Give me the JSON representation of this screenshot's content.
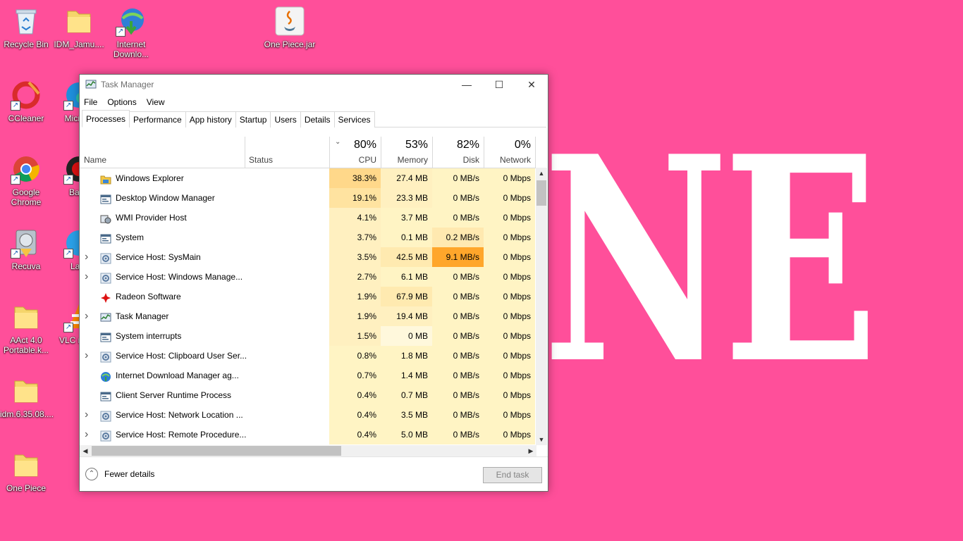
{
  "desktop": {
    "wallpaper_text": "NE",
    "icons": [
      {
        "label": "Recycle Bin",
        "icon": "recycle-bin-icon"
      },
      {
        "label": "IDM_Jamu....",
        "icon": "folder-icon"
      },
      {
        "label": "Internet Downlo...",
        "icon": "idm-icon"
      },
      {
        "label": "One Piece.jar",
        "icon": "java-icon"
      },
      {
        "label": "CCleaner",
        "icon": "ccleaner-icon"
      },
      {
        "label": "Micr Ed",
        "icon": "edge-icon"
      },
      {
        "label": "Google Chrome",
        "icon": "chrome-icon"
      },
      {
        "label": "Band",
        "icon": "bandicam-icon"
      },
      {
        "label": "Recuva",
        "icon": "recuva-icon"
      },
      {
        "label": "Lara",
        "icon": "app-icon"
      },
      {
        "label": "AAct 4.0 Portable.k...",
        "icon": "folder-icon"
      },
      {
        "label": "VLC m pla",
        "icon": "vlc-icon"
      },
      {
        "label": "idm.6.35.08....",
        "icon": "folder-icon"
      },
      {
        "label": "One Piece",
        "icon": "folder-icon"
      }
    ]
  },
  "window": {
    "title": "Task Manager",
    "menu": [
      "File",
      "Options",
      "View"
    ],
    "tabs": [
      "Processes",
      "Performance",
      "App history",
      "Startup",
      "Users",
      "Details",
      "Services"
    ],
    "active_tab": "Processes",
    "columns": {
      "name": "Name",
      "status": "Status",
      "cpu": {
        "pct": "80%",
        "label": "CPU"
      },
      "memory": {
        "pct": "53%",
        "label": "Memory"
      },
      "disk": {
        "pct": "82%",
        "label": "Disk"
      },
      "network": {
        "pct": "0%",
        "label": "Network"
      }
    },
    "processes": [
      {
        "name": "Windows Explorer",
        "expandable": false,
        "icon": "folder-app-icon",
        "cpu": "38.3%",
        "memory": "27.4 MB",
        "disk": "0 MB/s",
        "network": "0 Mbps",
        "cpu_color": "#ffd88a",
        "mem_color": "#fff0c0",
        "disk_color": "#fff4c4"
      },
      {
        "name": "Desktop Window Manager",
        "expandable": false,
        "icon": "window-app-icon",
        "cpu": "19.1%",
        "memory": "23.3 MB",
        "disk": "0 MB/s",
        "network": "0 Mbps",
        "cpu_color": "#ffe3a0",
        "mem_color": "#fff0c0",
        "disk_color": "#fff4c4"
      },
      {
        "name": "WMI Provider Host",
        "expandable": false,
        "icon": "wmi-icon",
        "cpu": "4.1%",
        "memory": "3.7 MB",
        "disk": "0 MB/s",
        "network": "0 Mbps",
        "cpu_color": "#fff0c0",
        "mem_color": "#fff4c4",
        "disk_color": "#fff4c4"
      },
      {
        "name": "System",
        "expandable": false,
        "icon": "window-app-icon",
        "cpu": "3.7%",
        "memory": "0.1 MB",
        "disk": "0.2 MB/s",
        "network": "0 Mbps",
        "cpu_color": "#fff0c0",
        "mem_color": "#fff4c4",
        "disk_color": "#ffe9b0"
      },
      {
        "name": "Service Host: SysMain",
        "expandable": true,
        "icon": "gear-icon",
        "cpu": "3.5%",
        "memory": "42.5 MB",
        "disk": "9.1 MB/s",
        "network": "0 Mbps",
        "cpu_color": "#fff0c0",
        "mem_color": "#ffeab0",
        "disk_color": "#ffa62b"
      },
      {
        "name": "Service Host: Windows Manage...",
        "expandable": true,
        "icon": "gear-icon",
        "cpu": "2.7%",
        "memory": "6.1 MB",
        "disk": "0 MB/s",
        "network": "0 Mbps",
        "cpu_color": "#fff0c0",
        "mem_color": "#fff4c4",
        "disk_color": "#fff4c4"
      },
      {
        "name": "Radeon Software",
        "expandable": false,
        "icon": "radeon-icon",
        "cpu": "1.9%",
        "memory": "67.9 MB",
        "disk": "0 MB/s",
        "network": "0 Mbps",
        "cpu_color": "#fff0c0",
        "mem_color": "#ffeab0",
        "disk_color": "#fff4c4"
      },
      {
        "name": "Task Manager",
        "expandable": true,
        "icon": "task-manager-icon",
        "cpu": "1.9%",
        "memory": "19.4 MB",
        "disk": "0 MB/s",
        "network": "0 Mbps",
        "cpu_color": "#fff0c0",
        "mem_color": "#fff0c0",
        "disk_color": "#fff4c4"
      },
      {
        "name": "System interrupts",
        "expandable": false,
        "icon": "window-app-icon",
        "cpu": "1.5%",
        "memory": "0 MB",
        "disk": "0 MB/s",
        "network": "0 Mbps",
        "cpu_color": "#fff0c0",
        "mem_color": "#fff8dc",
        "disk_color": "#fff4c4"
      },
      {
        "name": "Service Host: Clipboard User Ser...",
        "expandable": true,
        "icon": "gear-icon",
        "cpu": "0.8%",
        "memory": "1.8 MB",
        "disk": "0 MB/s",
        "network": "0 Mbps",
        "cpu_color": "#fff4c4",
        "mem_color": "#fff4c4",
        "disk_color": "#fff4c4"
      },
      {
        "name": "Internet Download Manager ag...",
        "expandable": false,
        "icon": "idm-icon",
        "cpu": "0.7%",
        "memory": "1.4 MB",
        "disk": "0 MB/s",
        "network": "0 Mbps",
        "cpu_color": "#fff4c4",
        "mem_color": "#fff4c4",
        "disk_color": "#fff4c4"
      },
      {
        "name": "Client Server Runtime Process",
        "expandable": false,
        "icon": "window-app-icon",
        "cpu": "0.4%",
        "memory": "0.7 MB",
        "disk": "0 MB/s",
        "network": "0 Mbps",
        "cpu_color": "#fff4c4",
        "mem_color": "#fff4c4",
        "disk_color": "#fff4c4"
      },
      {
        "name": "Service Host: Network Location ...",
        "expandable": true,
        "icon": "gear-icon",
        "cpu": "0.4%",
        "memory": "3.5 MB",
        "disk": "0 MB/s",
        "network": "0 Mbps",
        "cpu_color": "#fff4c4",
        "mem_color": "#fff4c4",
        "disk_color": "#fff4c4"
      },
      {
        "name": "Service Host: Remote Procedure...",
        "expandable": true,
        "icon": "gear-icon",
        "cpu": "0.4%",
        "memory": "5.0 MB",
        "disk": "0 MB/s",
        "network": "0 Mbps",
        "cpu_color": "#fff4c4",
        "mem_color": "#fff4c4",
        "disk_color": "#fff4c4"
      }
    ],
    "footer": {
      "fewer_details": "Fewer details",
      "end_task": "End task"
    }
  }
}
